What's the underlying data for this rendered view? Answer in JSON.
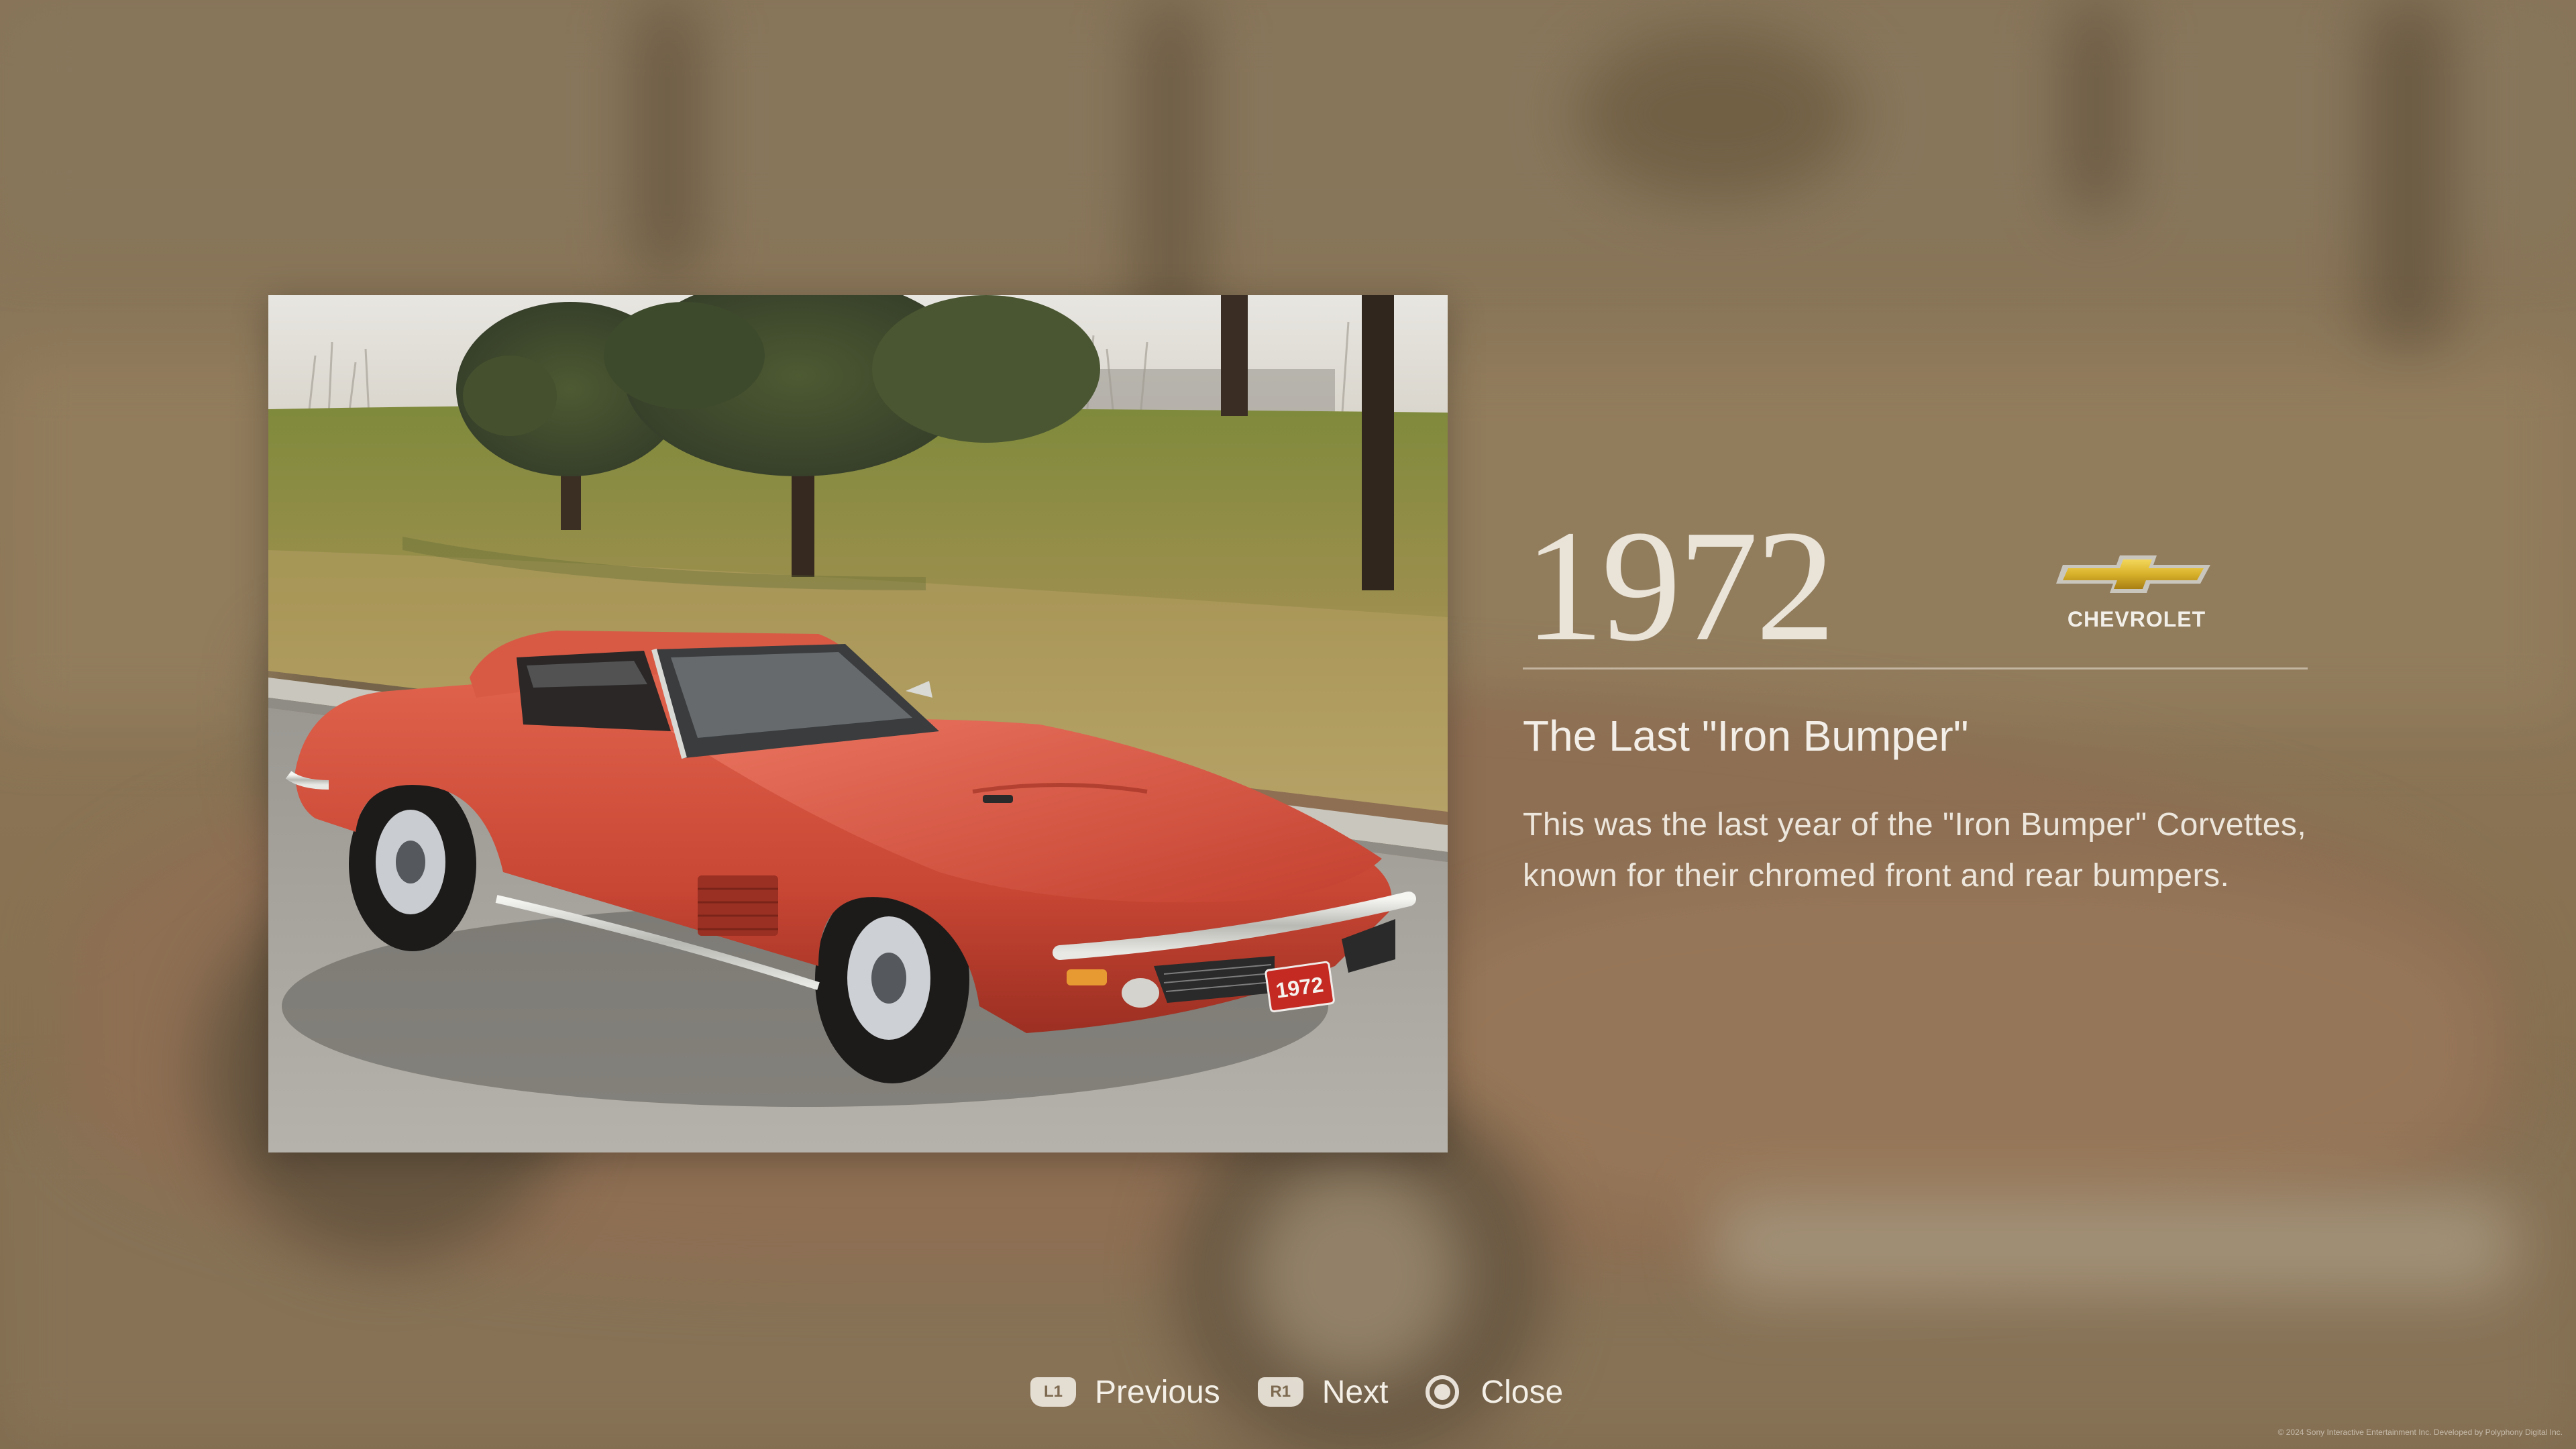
{
  "photo": {
    "plate_text": "1972",
    "alt": "red 1972 Chevrolet Corvette coupe parked on a road in front of a grassy hill with pine trees"
  },
  "info": {
    "year": "1972",
    "brand": "CHEVROLET",
    "subtitle": "The Last \"Iron Bumper\"",
    "description": "This was the last year of the \"Iron Bumper\" Corvettes, known for their chromed front and rear bumpers."
  },
  "controls": {
    "previous": {
      "button": "L1",
      "label": "Previous"
    },
    "next": {
      "button": "R1",
      "label": "Next"
    },
    "close": {
      "button_icon": "circle-button-icon",
      "label": "Close"
    }
  },
  "footer": {
    "copyright": "© 2024 Sony Interactive Entertainment Inc. Developed by Polyphony Digital Inc."
  },
  "colors": {
    "background": "#8f7a5c",
    "text": "#f3efe8",
    "car_red": "#c84634",
    "bowtie_gold": "#d8b12a"
  }
}
